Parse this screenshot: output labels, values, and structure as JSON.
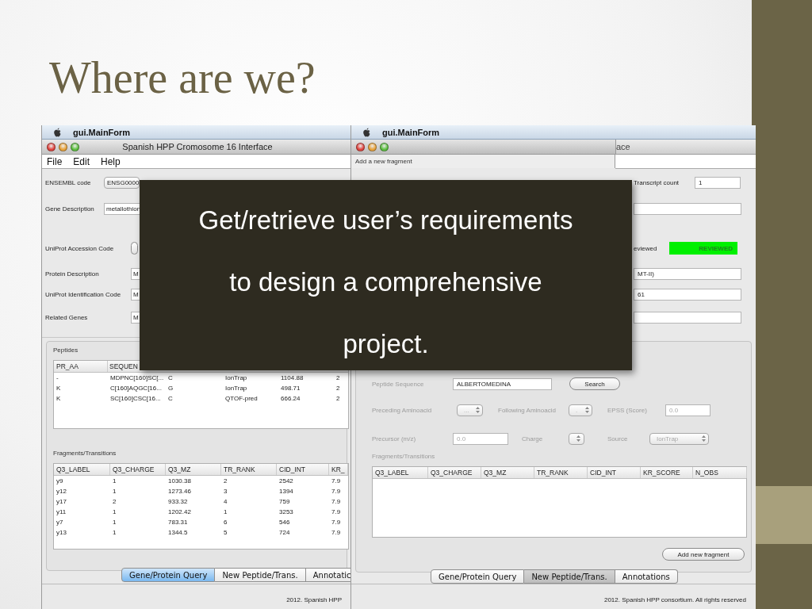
{
  "slide": {
    "title": "Where are we?",
    "callout_lines": [
      "Get/retrieve user’s requirements",
      "to design a comprehensive",
      "project."
    ]
  },
  "left_window": {
    "app_menu": "gui.MainForm",
    "title": "Spanish HPP Cromosome 16 Interface",
    "menu": [
      "File",
      "Edit",
      "Help"
    ],
    "form": [
      {
        "kind": "combo",
        "label": "ENSEMBL code",
        "value": "ENSG0000"
      },
      {
        "kind": "text",
        "label": "Gene Description",
        "value": "metallothion"
      },
      {
        "kind": "button",
        "label": "UniProt Accession Code"
      },
      {
        "kind": "text",
        "label": "Protein Description",
        "value": "M"
      },
      {
        "kind": "text",
        "label": "UniProt Identification Code",
        "value": "M"
      },
      {
        "kind": "text",
        "label": "Related Genes",
        "value": "M"
      }
    ],
    "peptides": {
      "title": "Peptides",
      "columns": [
        "PR_AA",
        "SEQUEN"
      ],
      "rows": [
        [
          "-",
          "MDPNC[160]SC[...",
          "C",
          "IonTrap",
          "1104.88",
          "2"
        ],
        [
          "K",
          "C[160]AQGC[16...",
          "G",
          "IonTrap",
          "498.71",
          "2"
        ],
        [
          "K",
          "SC[160]CSC[16...",
          "C",
          "QTOF-pred",
          "666.24",
          "2"
        ]
      ]
    },
    "fragments": {
      "title": "Fragments/Transitions",
      "columns": [
        "Q3_LABEL",
        "Q3_CHARGE",
        "Q3_MZ",
        "TR_RANK",
        "CID_INT",
        "KR_"
      ],
      "rows": [
        [
          "y9",
          "1",
          "1030.38",
          "2",
          "2542",
          "7.9"
        ],
        [
          "y12",
          "1",
          "1273.46",
          "3",
          "1394",
          "7.9"
        ],
        [
          "y17",
          "2",
          "933.32",
          "4",
          "759",
          "7.9"
        ],
        [
          "y11",
          "1",
          "1202.42",
          "1",
          "3253",
          "7.9"
        ],
        [
          "y7",
          "1",
          "783.31",
          "6",
          "546",
          "7.9"
        ],
        [
          "y13",
          "1",
          "1344.5",
          "5",
          "724",
          "7.9"
        ]
      ]
    },
    "tabs": [
      {
        "label": "Gene/Protein Query",
        "selected": true
      },
      {
        "label": "New Peptide/Trans.",
        "selected": false
      },
      {
        "label": "Annotatic",
        "selected": false
      }
    ],
    "status": "2012. Spanish HPP"
  },
  "right_window": {
    "app_menu": "gui.MainForm",
    "title": "ace",
    "dialog_title": "Add a new fragment",
    "form": [
      {
        "kind": "field",
        "label": "Transcript count",
        "value": "1"
      },
      {
        "kind": "field"
      },
      {
        "kind": "status",
        "label": "eviewed",
        "value": "REVIEWED"
      },
      {
        "kind": "field",
        "value": "MT-II)"
      },
      {
        "kind": "field",
        "value": "61"
      },
      {
        "kind": "field"
      }
    ],
    "peptide_form": {
      "disabled": true,
      "sequence": {
        "label": "Peptide Sequence",
        "value": "ALBERTOMEDINA"
      },
      "search_button": "Search",
      "preceding": {
        "label": "Preceding Aminoacid",
        "value": "..."
      },
      "following": {
        "label": "Following Aminoacid",
        "value": "."
      },
      "epss": {
        "label": "EPSS (Score)",
        "value": "0.0"
      },
      "precursor": {
        "label": "Precursor (m/z)",
        "value": "0.0"
      },
      "charge": {
        "label": "Charge"
      },
      "source": {
        "label": "Source",
        "value": "IonTrap"
      },
      "fragments_title": "Fragments/Transitions",
      "columns": [
        "Q3_LABEL",
        "Q3_CHARGE",
        "Q3_MZ",
        "TR_RANK",
        "CID_INT",
        "KR_SCORE",
        "N_OBS"
      ],
      "add_button": "Add new fragment"
    },
    "tabs": [
      {
        "label": "Gene/Protein Query",
        "selected": false
      },
      {
        "label": "New Peptide/Trans.",
        "selected": true
      },
      {
        "label": "Annotations",
        "selected": false
      }
    ],
    "status": "2012. Spanish HPP consortium. All rights reserved"
  }
}
